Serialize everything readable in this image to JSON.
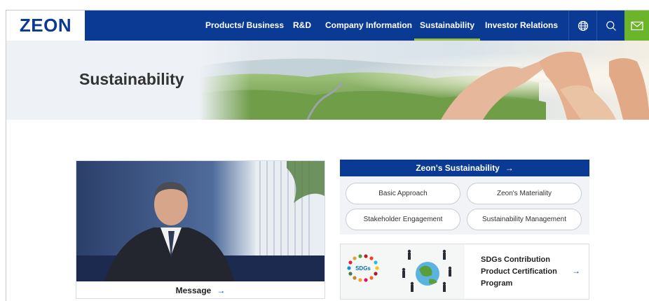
{
  "brand": {
    "logo_text": "ZEON",
    "primary_color": "#0a3a94",
    "accent_color": "#9bc13c",
    "mail_color": "#6cb42a"
  },
  "nav": {
    "items": [
      {
        "label": "Products/ Business",
        "active": false
      },
      {
        "label": "R&D",
        "active": false
      },
      {
        "label": "Company Information",
        "active": false
      },
      {
        "label": "Sustainability",
        "active": true
      },
      {
        "label": "Investor Relations",
        "active": false
      }
    ],
    "icons": [
      "globe-icon",
      "search-icon",
      "mail-icon"
    ]
  },
  "hero": {
    "title": "Sustainability"
  },
  "message_card": {
    "label": "Message",
    "arrow": "→"
  },
  "sustainability_panel": {
    "heading": "Zeon's Sustainability",
    "arrow": "→",
    "links": [
      "Basic Approach",
      "Zeon's Materiality",
      "Stakeholder Engagement",
      "Sustainability Management"
    ]
  },
  "sdgs_card": {
    "badge": "SDGs",
    "title": "SDGs Contribution Product Certification Program",
    "arrow": "→"
  }
}
